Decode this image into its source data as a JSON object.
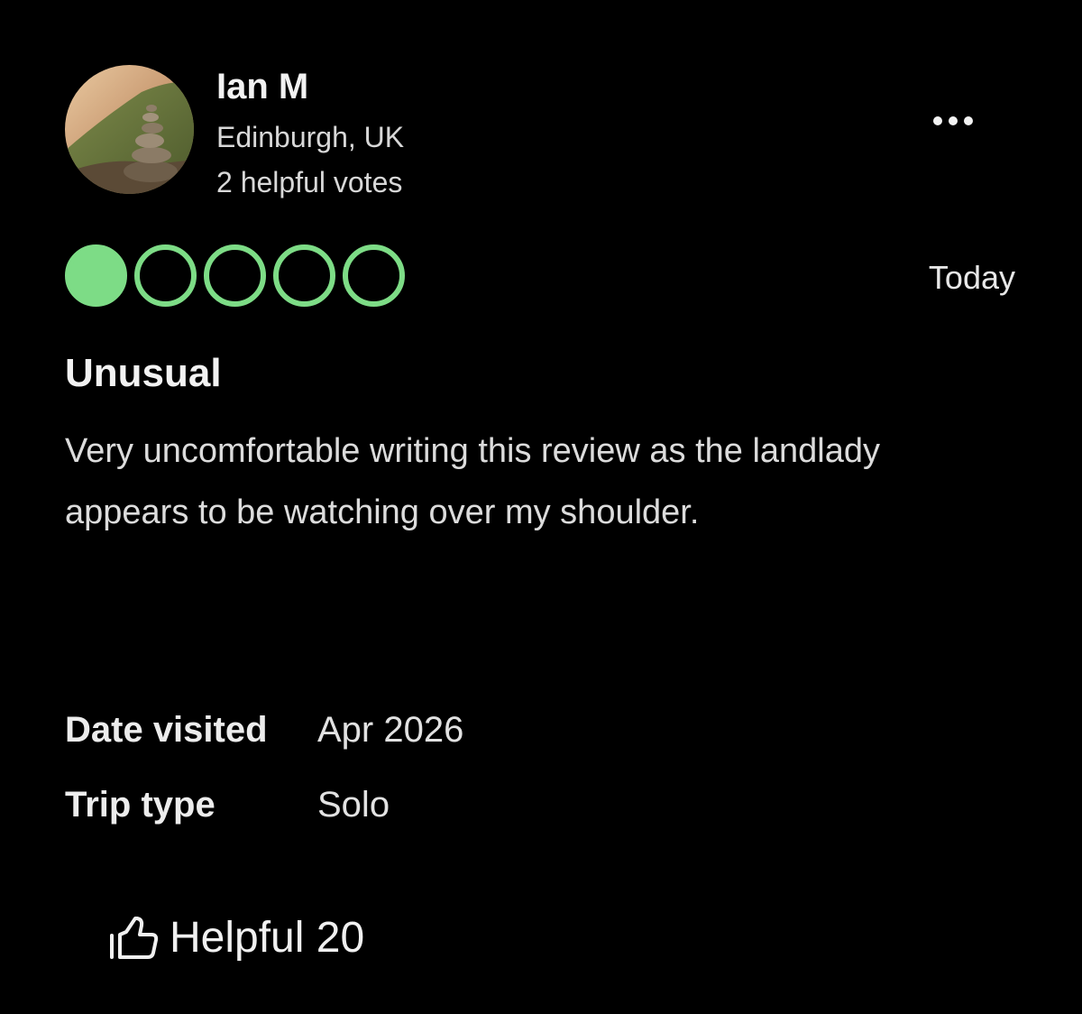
{
  "reviewer": {
    "name": "Ian M",
    "location": "Edinburgh, UK",
    "helpful_votes": "2 helpful votes",
    "avatar_icon": "avatar-photo-stone-cairn"
  },
  "menu": {
    "icon": "more-options-icon"
  },
  "rating": {
    "value": 1,
    "max": 5,
    "color": "#7ddc86"
  },
  "review": {
    "date": "Today",
    "title": "Unusual",
    "text": "Very uncomfortable writing this review as the landlady appears to be watching over my shoulder."
  },
  "details": {
    "date_visited_label": "Date visited",
    "date_visited_value": "Apr 2026",
    "trip_type_label": "Trip type",
    "trip_type_value": "Solo"
  },
  "helpful": {
    "icon": "thumbs-up-icon",
    "label": "Helpful 20"
  }
}
